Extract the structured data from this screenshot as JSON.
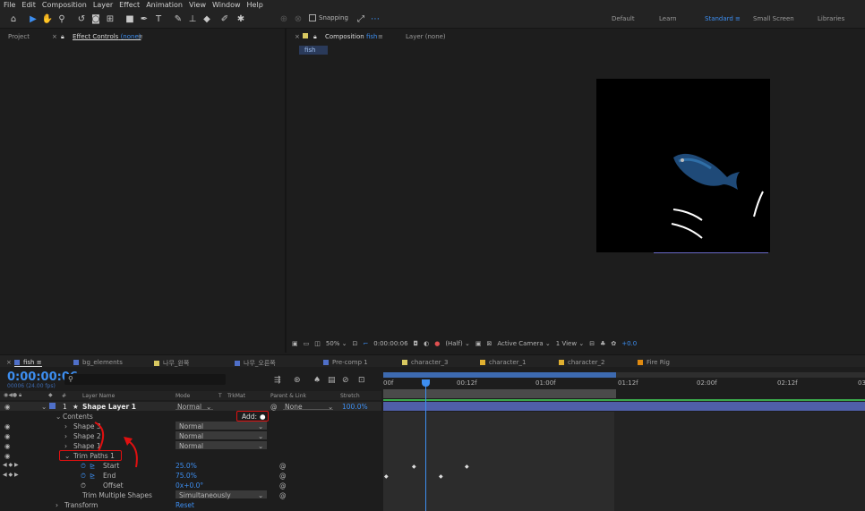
{
  "menu": [
    "File",
    "Edit",
    "Composition",
    "Layer",
    "Effect",
    "Animation",
    "View",
    "Window",
    "Help"
  ],
  "toolbar": {
    "snapping": "Snapping"
  },
  "workspaces": [
    "Default",
    "Learn",
    "Standard",
    "Small Screen",
    "Libraries"
  ],
  "left_panel": {
    "project": "Project",
    "effect_controls": "Effect Controls",
    "ec_none": "(none)"
  },
  "comp_panel": {
    "tab": "Composition",
    "comp_name": "fish",
    "layer_tab": "Layer (none)",
    "chip": "fish"
  },
  "viewer_bar": {
    "zoom": "50%",
    "timecode": "0:00:00:06",
    "quality": "(Half)",
    "camera": "Active Camera",
    "views": "1 View",
    "exposure": "+0.0"
  },
  "comp_tabs": [
    "fish",
    "bg_elements",
    "나무_왼쪽",
    "나무_오른쪽",
    "Pre-comp 1",
    "character_3",
    "character_1",
    "character_2",
    "Fire Rig"
  ],
  "comp_tab_colors": [
    "#4f6fc8",
    "#4f6fc8",
    "#d8c860",
    "#4f6fc8",
    "#4f6fc8",
    "#d8c860",
    "#e0b030",
    "#e0b030",
    "#e08a10"
  ],
  "timeline": {
    "timecode": "0:00:00:06",
    "fps": "00006 (24.00 fps)",
    "search_placeholder": "",
    "headers": {
      "num": "#",
      "layer_name": "Layer Name",
      "mode": "Mode",
      "t": "T",
      "trkmat": "TrkMat",
      "parent": "Parent & Link",
      "stretch": "Stretch"
    },
    "ruler": [
      "00f",
      "00:12f",
      "01:00f",
      "01:12f",
      "02:00f",
      "02:12f",
      "03"
    ],
    "layer": {
      "num": "1",
      "name": "Shape Layer 1",
      "mode": "Normal",
      "parent": "None",
      "stretch": "100.0%"
    },
    "rows": {
      "contents": "Contents",
      "add": "Add:",
      "shape3": "Shape 3",
      "shape2": "Shape 2",
      "shape1": "Shape 1",
      "normal": "Normal",
      "trim": "Trim Paths 1",
      "start_label": "Start",
      "start_val": "25.0%",
      "end_label": "End",
      "end_val": "75.0%",
      "offset_label": "Offset",
      "offset_val": "0x+0.0°",
      "tms_label": "Trim Multiple Shapes",
      "tms_val": "Simultaneously",
      "transform_label": "Transform",
      "transform_val": "Reset"
    }
  },
  "colors": {
    "accent": "#3d8ef0",
    "annotation": "#e01010",
    "layer_bar": "#4f5fa8",
    "label_blue": "#4f6fc8"
  }
}
